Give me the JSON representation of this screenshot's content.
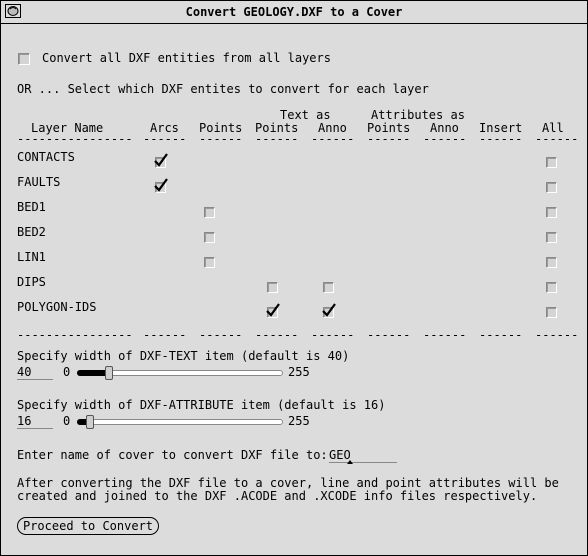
{
  "window": {
    "title": "Convert GEOLOGY.DXF to a Cover"
  },
  "convert_all": {
    "label": "Convert all DXF entities from all layers",
    "checked": false
  },
  "or_text": "OR ... Select which DXF entites to convert for each layer",
  "columns": {
    "group_text": "Text as",
    "group_attr": "Attributes as",
    "layer_name": "Layer Name",
    "arcs": "Arcs",
    "points": "Points",
    "text_points": "Points",
    "text_anno": "Anno",
    "attr_points": "Points",
    "attr_anno": "Anno",
    "insert": "Insert",
    "all": "All"
  },
  "rows": [
    {
      "name": "CONTACTS",
      "arcs": true,
      "points": null,
      "text_points": null,
      "text_anno": null,
      "all": false
    },
    {
      "name": "FAULTS",
      "arcs": true,
      "points": null,
      "text_points": null,
      "text_anno": null,
      "all": false
    },
    {
      "name": "BED1",
      "arcs": null,
      "points": false,
      "text_points": null,
      "text_anno": null,
      "all": false
    },
    {
      "name": "BED2",
      "arcs": null,
      "points": false,
      "text_points": null,
      "text_anno": null,
      "all": false
    },
    {
      "name": "LIN1",
      "arcs": null,
      "points": false,
      "text_points": null,
      "text_anno": null,
      "all": false
    },
    {
      "name": "DIPS",
      "arcs": null,
      "points": null,
      "text_points": false,
      "text_anno": false,
      "all": false
    },
    {
      "name": "POLYGON-IDS",
      "arcs": null,
      "points": null,
      "text_points": true,
      "text_anno": true,
      "all": false
    }
  ],
  "dash_row": {
    "layer": "----------------",
    "arcs": "------",
    "points": "------",
    "text_points": "------",
    "text_anno": "------",
    "attr_points": "------",
    "attr_anno": "------",
    "insert": "------",
    "all": "------"
  },
  "dxf_text": {
    "label": "Specify width of DXF-TEXT item (default is 40)",
    "value": "40",
    "min": "0",
    "max": "255",
    "level": 40
  },
  "dxf_attr": {
    "label": "Specify width of DXF-ATTRIBUTE item (default is 16)",
    "value": "16",
    "min": "0",
    "max": "255",
    "level": 16
  },
  "cover": {
    "label": "Enter name of cover to convert DXF file to:",
    "value": "GEO"
  },
  "info": {
    "line1": "After converting the DXF file to a cover, line and point attributes will be",
    "line2": "created and joined to the DXF .ACODE and .XCODE info files respectively."
  },
  "proceed_button": "Proceed to Convert"
}
